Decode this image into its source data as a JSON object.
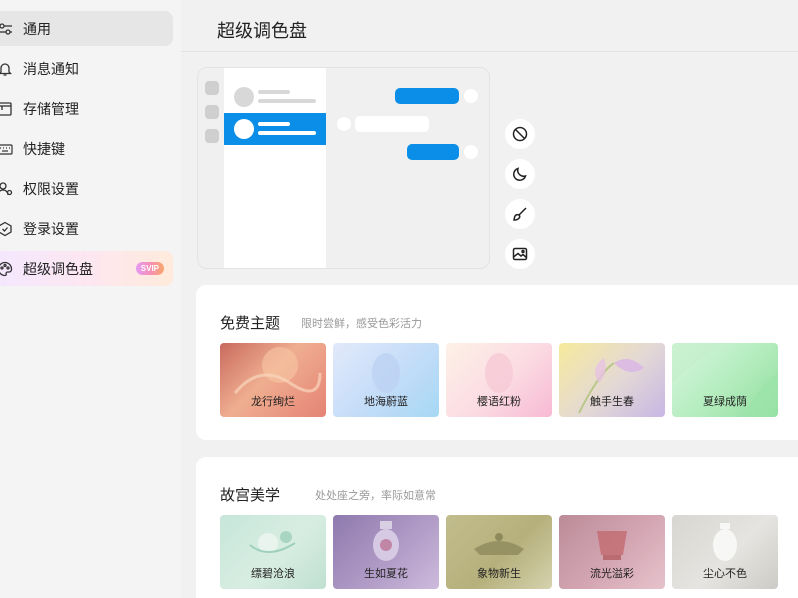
{
  "sidebar": {
    "items": [
      {
        "label": "通用",
        "icon": "sliders-icon",
        "active": true
      },
      {
        "label": "消息通知",
        "icon": "bell-icon"
      },
      {
        "label": "存储管理",
        "icon": "storage-icon"
      },
      {
        "label": "快捷键",
        "icon": "keyboard-icon"
      },
      {
        "label": "权限设置",
        "icon": "user-permission-icon"
      },
      {
        "label": "登录设置",
        "icon": "shield-icon"
      },
      {
        "label": "超级调色盘",
        "icon": "palette-icon",
        "badge": "SVIP"
      }
    ]
  },
  "header": {
    "title": "超级调色盘"
  },
  "modes": [
    "none-icon",
    "moon-icon",
    "brush-icon",
    "image-icon"
  ],
  "sections": [
    {
      "title": "免费主题",
      "subtitle": "限时尝鲜，感受色彩活力",
      "themes": [
        {
          "label": "龙行绚烂",
          "colors": [
            "#e07a6a",
            "#f3b694",
            "#d9574a"
          ]
        },
        {
          "label": "地海蔚蓝",
          "colors": [
            "#d7e4fb",
            "#aedcf7",
            "#c7d6f4"
          ]
        },
        {
          "label": "樱语红粉",
          "colors": [
            "#fbeee6",
            "#fcd6e0",
            "#f8b3cf"
          ]
        },
        {
          "label": "触手生春",
          "colors": [
            "#f6e9a2",
            "#d8d7e9",
            "#c7b6e2"
          ]
        },
        {
          "label": "夏绿成荫",
          "colors": [
            "#d6f5dc",
            "#aeeab8",
            "#8fdf9f"
          ]
        }
      ]
    },
    {
      "title": "故宫美学",
      "subtitle": "处处座之旁，率际如意常",
      "themes": [
        {
          "label": "缥碧沧浪",
          "colors": [
            "#cfe9e0",
            "#b5dbcd",
            "#d9ecdf"
          ]
        },
        {
          "label": "生如夏花",
          "colors": [
            "#9d8ab8",
            "#b39bc8",
            "#c9b8d8"
          ]
        },
        {
          "label": "象物新生",
          "colors": [
            "#c8c498",
            "#bdb885",
            "#d9d6b6"
          ]
        },
        {
          "label": "流光溢彩",
          "colors": [
            "#c59aa5",
            "#d8aab6",
            "#e8c3cd"
          ]
        },
        {
          "label": "尘心不色",
          "colors": [
            "#dad9d4",
            "#cfceca",
            "#e6e5e1"
          ]
        }
      ]
    }
  ]
}
